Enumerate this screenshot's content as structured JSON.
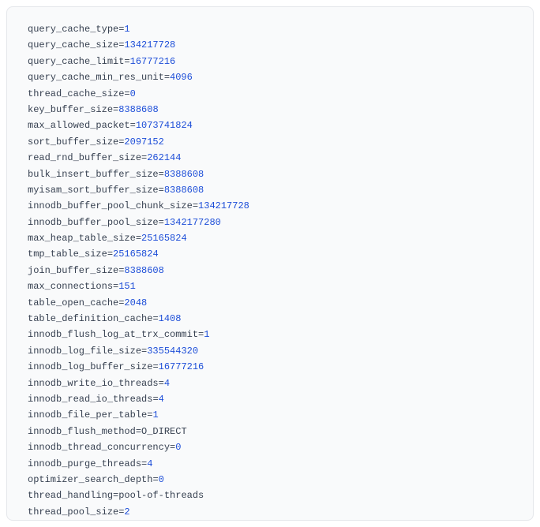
{
  "config": [
    {
      "key": "query_cache_type",
      "value": "1",
      "type": "num"
    },
    {
      "key": "query_cache_size",
      "value": "134217728",
      "type": "num"
    },
    {
      "key": "query_cache_limit",
      "value": "16777216",
      "type": "num"
    },
    {
      "key": "query_cache_min_res_unit",
      "value": "4096",
      "type": "num"
    },
    {
      "key": "thread_cache_size",
      "value": "0",
      "type": "num"
    },
    {
      "key": "key_buffer_size",
      "value": "8388608",
      "type": "num"
    },
    {
      "key": "max_allowed_packet",
      "value": "1073741824",
      "type": "num"
    },
    {
      "key": "sort_buffer_size",
      "value": "2097152",
      "type": "num"
    },
    {
      "key": "read_rnd_buffer_size",
      "value": "262144",
      "type": "num"
    },
    {
      "key": "bulk_insert_buffer_size",
      "value": "8388608",
      "type": "num"
    },
    {
      "key": "myisam_sort_buffer_size",
      "value": "8388608",
      "type": "num"
    },
    {
      "key": "innodb_buffer_pool_chunk_size",
      "value": "134217728",
      "type": "num"
    },
    {
      "key": "innodb_buffer_pool_size",
      "value": "1342177280",
      "type": "num"
    },
    {
      "key": "max_heap_table_size",
      "value": "25165824",
      "type": "num"
    },
    {
      "key": "tmp_table_size",
      "value": "25165824",
      "type": "num"
    },
    {
      "key": "join_buffer_size",
      "value": "8388608",
      "type": "num"
    },
    {
      "key": "max_connections",
      "value": "151",
      "type": "num"
    },
    {
      "key": "table_open_cache",
      "value": "2048",
      "type": "num"
    },
    {
      "key": "table_definition_cache",
      "value": "1408",
      "type": "num"
    },
    {
      "key": "innodb_flush_log_at_trx_commit",
      "value": "1",
      "type": "num"
    },
    {
      "key": "innodb_log_file_size",
      "value": "335544320",
      "type": "num"
    },
    {
      "key": "innodb_log_buffer_size",
      "value": "16777216",
      "type": "num"
    },
    {
      "key": "innodb_write_io_threads",
      "value": "4",
      "type": "num"
    },
    {
      "key": "innodb_read_io_threads",
      "value": "4",
      "type": "num"
    },
    {
      "key": "innodb_file_per_table",
      "value": "1",
      "type": "num"
    },
    {
      "key": "innodb_flush_method",
      "value": "O_DIRECT",
      "type": "str"
    },
    {
      "key": "innodb_thread_concurrency",
      "value": "0",
      "type": "num"
    },
    {
      "key": "innodb_purge_threads",
      "value": "4",
      "type": "num"
    },
    {
      "key": "optimizer_search_depth",
      "value": "0",
      "type": "num"
    },
    {
      "key": "thread_handling",
      "value": "pool-of-threads",
      "type": "str"
    },
    {
      "key": "thread_pool_size",
      "value": "2",
      "type": "num"
    }
  ]
}
